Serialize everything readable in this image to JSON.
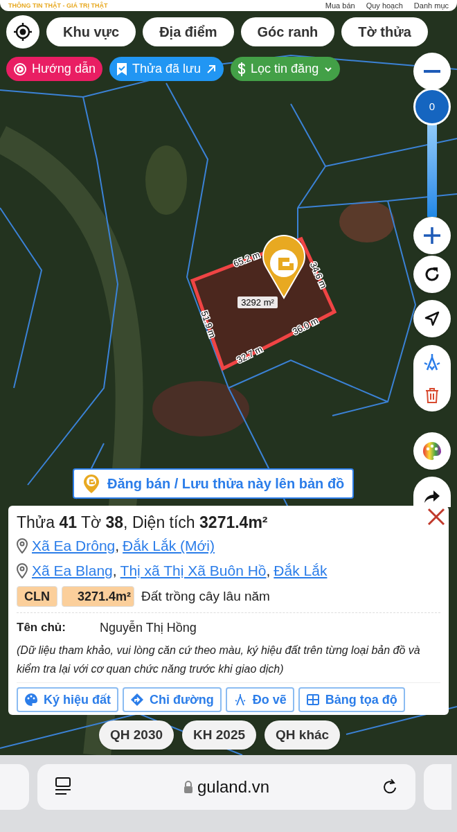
{
  "header": {
    "tagline": "THÔNG TIN THẬT - GIÁ TRỊ THẬT",
    "menu": [
      "Mua bán",
      "Quy hoạch",
      "Danh mục"
    ]
  },
  "search_tabs": [
    "Khu vực",
    "Địa điểm",
    "Góc ranh",
    "Tờ thửa"
  ],
  "chips": [
    {
      "label": "Hướng dẫn",
      "kind": "guide",
      "color": "#e91e63"
    },
    {
      "label": "Thửa đã lưu",
      "kind": "saved",
      "color": "#2196f3"
    },
    {
      "label": "Lọc tin đăng",
      "kind": "filter",
      "color": "#43a047"
    }
  ],
  "zoom": {
    "value": "0"
  },
  "parcel": {
    "area_label": "3292 m²",
    "edges": [
      "65.2 m",
      "34.6 m",
      "36.0 m",
      "32.7 m",
      "51.9 m"
    ]
  },
  "cta": "Đăng bán / Lưu thửa này lên bản đồ",
  "info": {
    "title": "Thửa **41** Tờ **38**, Diện tích **3271.4m²**",
    "addresses": [
      [
        {
          "text": "Xã Ea Drông",
          "link": true
        },
        {
          "text": ",",
          "link": false
        },
        {
          "text": "Đắk Lắk (Mới)",
          "link": true
        }
      ],
      [
        {
          "text": "Xã Ea Blang",
          "link": true
        },
        {
          "text": ",",
          "link": false
        },
        {
          "text": "Thị xã Thị Xã Buôn Hồ",
          "link": true
        },
        {
          "text": ",",
          "link": false
        },
        {
          "text": "Đắk Lắk",
          "link": true
        }
      ]
    ],
    "land": {
      "code": "CLN",
      "area": "3271.4m²",
      "name": "Đất trồng cây lâu năm"
    },
    "owner": {
      "label": "Tên chủ:",
      "value": "Nguyễn Thị Hồng"
    },
    "note": "(Dữ liệu tham khảo, vui lòng căn cứ theo màu, ký hiệu đất trên từng loại bản đồ và kiểm tra lại với cơ quan chức năng trước khi giao dịch)",
    "actions": [
      {
        "label": "Ký hiệu đất",
        "kind": "palette"
      },
      {
        "label": "Chỉ đường",
        "kind": "directions"
      },
      {
        "label": "Đo vẽ",
        "kind": "measure"
      },
      {
        "label": "Bảng tọa độ",
        "kind": "table"
      }
    ]
  },
  "plan_buttons": [
    "QH 2030",
    "KH 2025",
    "QH khác"
  ],
  "browser": {
    "url": "guland.vn"
  }
}
